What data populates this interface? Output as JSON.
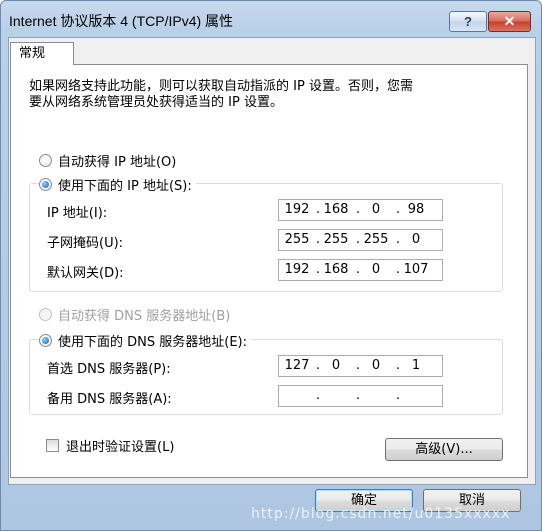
{
  "window": {
    "title": "Internet 协议版本 4 (TCP/IPv4) 属性",
    "help_label": "?",
    "close_label": "✕"
  },
  "tab": {
    "label": "常规"
  },
  "description": "如果网络支持此功能，则可以获取自动指派的 IP 设置。否则，您需\n要从网络系统管理员处获得适当的 IP 设置。",
  "ip_section": {
    "auto_label": "自动获得 IP 地址(O)",
    "manual_label": "使用下面的 IP 地址(S):",
    "selected": "manual",
    "fields": [
      {
        "label": "IP 地址(I):",
        "octets": [
          "192",
          "168",
          "0",
          "98"
        ]
      },
      {
        "label": "子网掩码(U):",
        "octets": [
          "255",
          "255",
          "255",
          "0"
        ]
      },
      {
        "label": "默认网关(D):",
        "octets": [
          "192",
          "168",
          "0",
          "107"
        ]
      }
    ]
  },
  "dns_section": {
    "auto_label": "自动获得 DNS 服务器地址(B)",
    "manual_label": "使用下面的 DNS 服务器地址(E):",
    "selected": "manual",
    "auto_disabled": true,
    "fields": [
      {
        "label": "首选 DNS 服务器(P):",
        "octets": [
          "127",
          "0",
          "0",
          "1"
        ]
      },
      {
        "label": "备用 DNS 服务器(A):",
        "octets": [
          "",
          "",
          "",
          ""
        ]
      }
    ]
  },
  "validate_checkbox": {
    "label": "退出时验证设置(L)",
    "checked": false
  },
  "advanced_button": "高级(V)...",
  "ok_button": "确定",
  "cancel_button": "取消",
  "watermark": "http://blog.csdn.net/u0135xxxxx"
}
